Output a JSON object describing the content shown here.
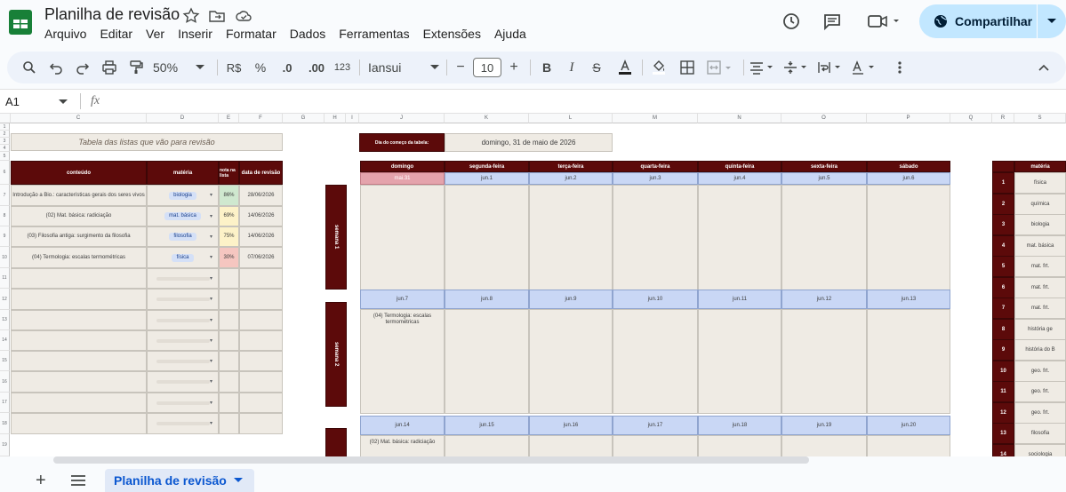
{
  "app": {
    "title": "Planilha de revisão",
    "share_label": "Compartilhar",
    "brand_color": "#188038",
    "share_bg": "#c2e7ff"
  },
  "menu": [
    "Arquivo",
    "Editar",
    "Ver",
    "Inserir",
    "Formatar",
    "Dados",
    "Ferramentas",
    "Extensões",
    "Ajuda"
  ],
  "toolbar": {
    "currency": "R$",
    "percent": "%",
    "dec_less": ".0",
    "dec_more": ".00",
    "format_123": "123",
    "zoom": "50%",
    "font": "Iansui",
    "font_size": "10"
  },
  "formula": {
    "cell_ref": "A1",
    "fx": "fx",
    "value": ""
  },
  "columns": [
    "C",
    "D",
    "E",
    "F",
    "G",
    "H",
    "I",
    "J",
    "K",
    "L",
    "M",
    "N",
    "O",
    "P",
    "Q",
    "R",
    "S"
  ],
  "rows": [
    "1",
    "2",
    "3",
    "4",
    "5",
    "6",
    "7",
    "8",
    "9",
    "10",
    "11",
    "12",
    "13",
    "14",
    "15",
    "16",
    "17",
    "18",
    "19"
  ],
  "left_table": {
    "title": "Tabela das listas que vão para revisão",
    "headers": [
      "conteúdo",
      "matéria",
      "nota na lista",
      "data de revisão"
    ],
    "rows": [
      {
        "content": "Introdução a Bio.: características gerais dos seres vivos",
        "subject": "biologia",
        "grade": "86%",
        "date": "28/06/2026",
        "grade_color": "#cfe8cf"
      },
      {
        "content": "(02) Mat. básica: radiciação",
        "subject": "mat. básica",
        "grade": "69%",
        "date": "14/06/2026",
        "grade_color": "#fdf2c8"
      },
      {
        "content": "(03) Filosofia antiga: surgimento da filosofia",
        "subject": "filosofia",
        "grade": "75%",
        "date": "14/06/2026",
        "grade_color": "#fdf2c8"
      },
      {
        "content": "(04) Termologia: escalas termométricas",
        "subject": "física",
        "grade": "30%",
        "date": "07/06/2026",
        "grade_color": "#f5c6c0"
      }
    ]
  },
  "start": {
    "label": "Dia do começo da tabela:",
    "value": "domingo, 31 de maio de 2026"
  },
  "calendar": {
    "days": [
      "domingo",
      "segunda-feira",
      "terça-feira",
      "quarta-feira",
      "quinta-feira",
      "sexta-feira",
      "sábado"
    ],
    "weeks": [
      {
        "label": "semana 1",
        "dates": [
          "mai.31",
          "jun.1",
          "jun.2",
          "jun.3",
          "jun.4",
          "jun.5",
          "jun.6"
        ],
        "entries": [
          "",
          "",
          "",
          "",
          "",
          "",
          ""
        ]
      },
      {
        "label": "semana 2",
        "dates": [
          "jun.7",
          "jun.8",
          "jun.9",
          "jun.10",
          "jun.11",
          "jun.12",
          "jun.13"
        ],
        "entries": [
          "(04) Termologia: escalas termométricas",
          "",
          "",
          "",
          "",
          "",
          ""
        ]
      },
      {
        "label": "",
        "dates": [
          "jun.14",
          "jun.15",
          "jun.16",
          "jun.17",
          "jun.18",
          "jun.19",
          "jun.20"
        ],
        "entries": [
          "(02) Mat. básica: radiciação",
          "",
          "",
          "",
          "",
          "",
          ""
        ]
      }
    ]
  },
  "right_table": {
    "header": "matéria",
    "numbers": [
      "1",
      "2",
      "3",
      "4",
      "5",
      "6",
      "7",
      "8",
      "9",
      "10",
      "11",
      "12",
      "13",
      "14"
    ],
    "subjects": [
      "física",
      "química",
      "biologia",
      "mat. básica",
      "mat. frt.",
      "mat. frt.",
      "mat. frt.",
      "história ge",
      "história do B",
      "geo. frt.",
      "geo. frt.",
      "geo. frt.",
      "filosofia",
      "sociologia"
    ]
  },
  "sheet": {
    "tab_label": "Planilha de revisão"
  }
}
